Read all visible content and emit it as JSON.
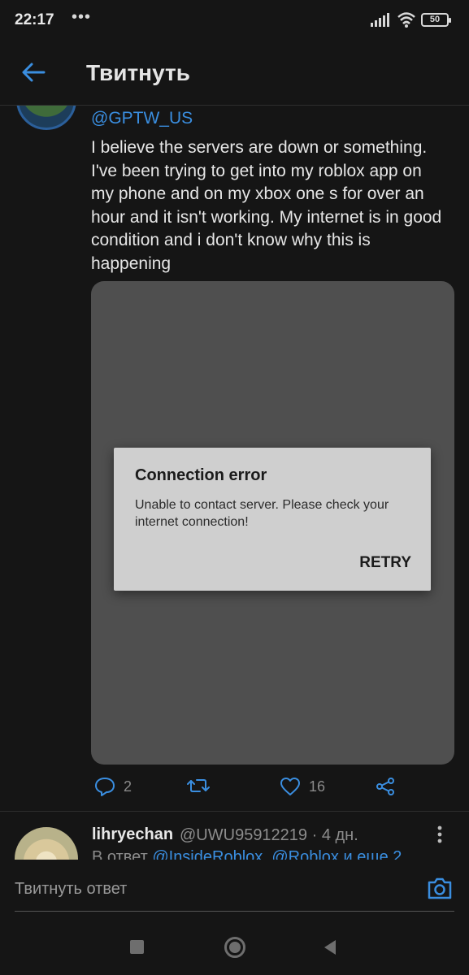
{
  "status_bar": {
    "time": "22:17",
    "dots": "•••",
    "battery_level": "50"
  },
  "header": {
    "title": "Твитнуть"
  },
  "tweet": {
    "handle": "@GPTW_US",
    "text": "I believe the servers are down or something. I've been trying to get into my roblox app on my phone and on my xbox one s for over an hour and it isn't working. My internet is in good condition and i don't know why this is happening",
    "media": {
      "dialog_title": "Connection error",
      "dialog_message": "Unable to contact server. Please check your internet connection!",
      "dialog_button": "RETRY"
    },
    "actions": {
      "replies": "2",
      "likes": "16"
    }
  },
  "reply": {
    "name": "lihryechan",
    "meta": "@UWU95912219 · 4 дн.",
    "reply_to_prefix": "В ответ ",
    "reply_to_mentions": "@InsideRoblox, @Roblox и еще 2"
  },
  "composer": {
    "placeholder": "Твитнуть ответ"
  },
  "colors": {
    "background": "#151515",
    "accent": "#3a8ee0",
    "text": "#e6e6e6",
    "muted": "#8a8a8a",
    "media_bg": "#4f4f4f",
    "dialog_bg": "#cfcfcf"
  },
  "icons": [
    "signal-icon",
    "wifi-icon",
    "battery-icon",
    "back-arrow-icon",
    "reply-icon",
    "retweet-icon",
    "like-icon",
    "share-icon",
    "more-icon",
    "camera-icon"
  ]
}
